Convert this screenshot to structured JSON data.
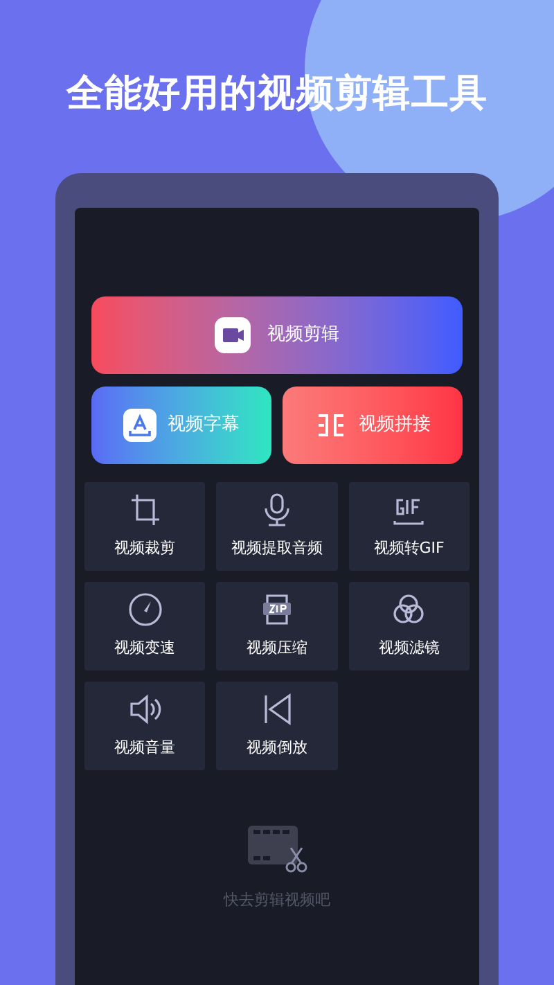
{
  "headline": "全能好用的视频剪辑工具",
  "main_actions": [
    {
      "label": "视频剪辑"
    },
    {
      "label": "视频字幕"
    },
    {
      "label": "视频拼接"
    }
  ],
  "tools": [
    {
      "label": "视频裁剪"
    },
    {
      "label": "视频提取音频"
    },
    {
      "label": "视频转GIF"
    },
    {
      "label": "视频变速"
    },
    {
      "label": "视频压缩"
    },
    {
      "label": "视频滤镜"
    },
    {
      "label": "视频音量"
    },
    {
      "label": "视频倒放"
    }
  ],
  "empty_state": {
    "message": "快去剪辑视频吧"
  }
}
